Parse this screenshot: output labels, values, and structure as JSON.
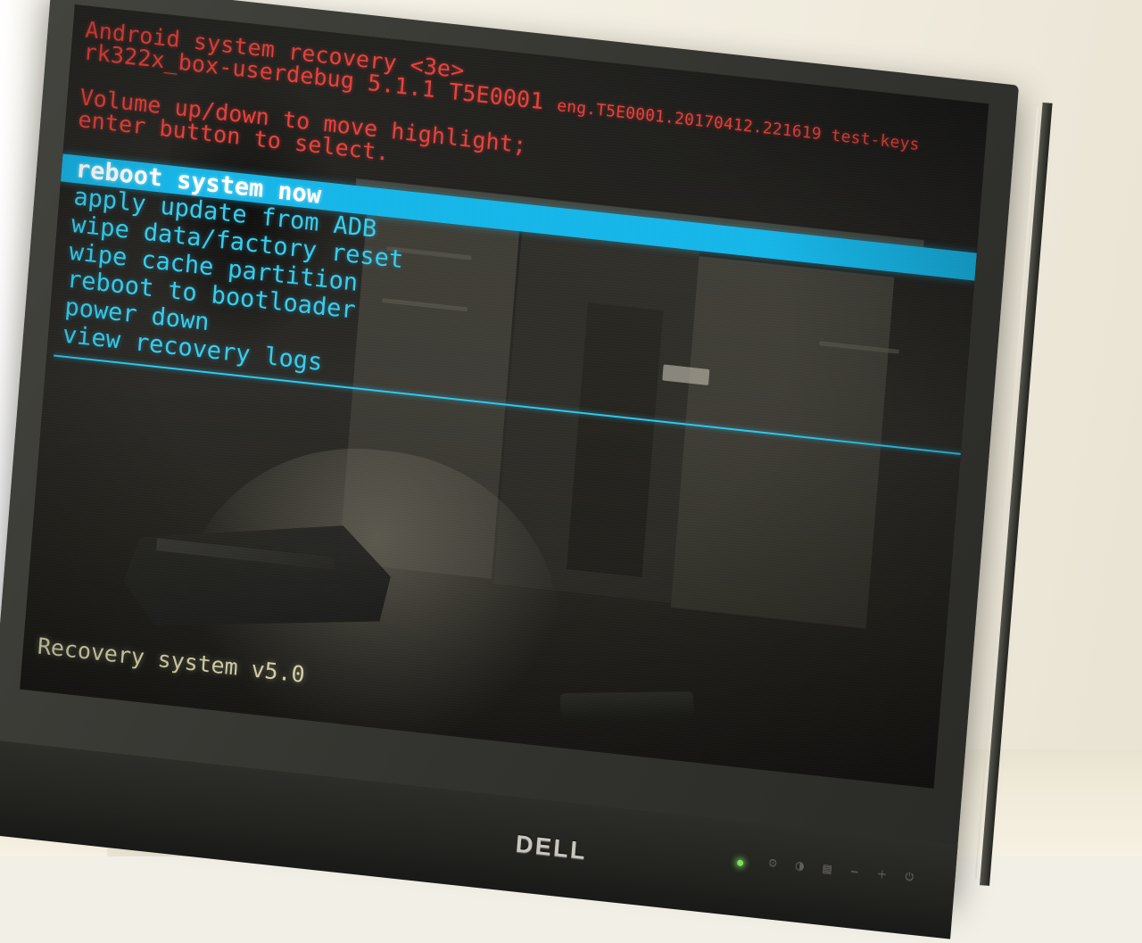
{
  "screen": {
    "header": {
      "line1": "Android system recovery <3e>",
      "line2_main": "rk322x_box-userdebug 5.1.1 T5E0001 ",
      "line2_fingerprint": "eng.T5E0001.20170412.221619 test-keys"
    },
    "instructions": {
      "line1": "Volume up/down to move highlight;",
      "line2": "enter button to select."
    },
    "menu": {
      "selected_index": 0,
      "items": [
        {
          "label": "reboot system now"
        },
        {
          "label": "apply update from ADB"
        },
        {
          "label": "wipe data/factory reset"
        },
        {
          "label": "wipe cache partition"
        },
        {
          "label": "reboot to bootloader"
        },
        {
          "label": "power down"
        },
        {
          "label": "view recovery logs"
        }
      ]
    },
    "footer": "Recovery system v5.0",
    "colors": {
      "header_red": "#e8413b",
      "menu_cyan": "#35cdf0",
      "highlight_bar": "#16b6e8",
      "highlight_text": "#ffffff",
      "footer_yellow": "#f7f3c4",
      "rule_cyan": "#2ec7ee",
      "screen_background": "#121210"
    }
  },
  "monitor": {
    "brand": "DELL",
    "osd_buttons": [
      {
        "icon": "input-source-icon",
        "glyph": "⊙"
      },
      {
        "icon": "brightness-icon",
        "glyph": "◑"
      },
      {
        "icon": "menu-icon",
        "glyph": "▤"
      },
      {
        "icon": "minus-icon",
        "glyph": "−"
      },
      {
        "icon": "plus-icon",
        "glyph": "＋"
      },
      {
        "icon": "power-icon",
        "glyph": "⏻"
      }
    ],
    "power_led": {
      "name": "power-led",
      "color": "#7ee05a"
    }
  }
}
